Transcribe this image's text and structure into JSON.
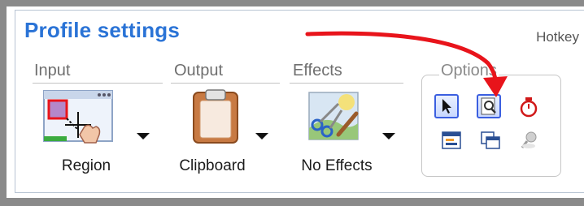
{
  "title": "Profile settings",
  "hotkey_label": "Hotkey",
  "groups": {
    "input": {
      "label": "Input",
      "button_label": "Region",
      "icon": "region-capture-icon"
    },
    "output": {
      "label": "Output",
      "button_label": "Clipboard",
      "icon": "clipboard-icon"
    },
    "effects": {
      "label": "Effects",
      "button_label": "No Effects",
      "icon": "paint-effects-icon"
    }
  },
  "options": {
    "label": "Options",
    "items": [
      {
        "icon": "cursor-icon",
        "active": true
      },
      {
        "icon": "magnifier-icon",
        "active": true
      },
      {
        "icon": "timer-icon",
        "active": false
      },
      {
        "icon": "window-icon",
        "active": false
      },
      {
        "icon": "multi-window-icon",
        "active": false
      },
      {
        "icon": "pin-icon",
        "active": false
      }
    ]
  },
  "colors": {
    "title": "#2a73d6",
    "annotation_arrow": "#e8141b",
    "active_option_border": "#3b5fe0"
  }
}
